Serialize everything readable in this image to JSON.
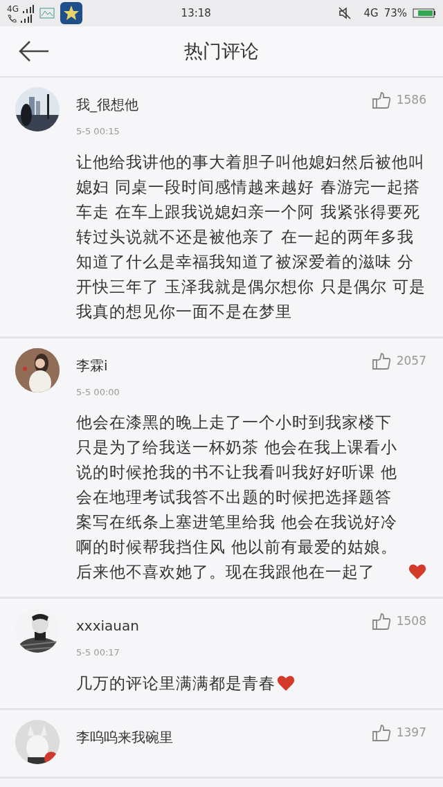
{
  "status_bar": {
    "network_top": "4G",
    "time": "13:18",
    "network_right": "4G",
    "battery": "73%"
  },
  "header": {
    "title": "热门评论"
  },
  "comments": [
    {
      "name": "我_很想他",
      "time": "5-5 00:15",
      "likes": "1586",
      "text": "让他给我讲他的事大着胆子叫他媳妇然后被他叫媳妇 同桌一段时间感情越来越好 春游完一起搭车走 在车上跟我说媳妇亲一个阿 我紧张得要死转过头说就不还是被他亲了 在一起的两年多我知道了什么是幸福我知道了被深爱着的滋味 分开快三年了 玉泽我就是偶尔想你 只是偶尔 可是我真的想见你一面不是在梦里",
      "heart": false
    },
    {
      "name": "李霖i",
      "time": "5-5 00:00",
      "likes": "2057",
      "text": "他会在漆黑的晚上走了一个小时到我家楼下只是为了给我送一杯奶茶 他会在我上课看小说的时候抢我的书不让我看叫我好好听课 他会在地理考试我答不出题的时候把选择题答案写在纸条上塞进笔里给我 他会在我说好冷啊的时候帮我挡住风 他以前有最爱的姑娘。后来他不喜欢她了。现在我跟他在一起了",
      "heart": true
    },
    {
      "name": "xxxiauan",
      "time": "5-5 00:17",
      "likes": "1508",
      "text": "几万的评论里满满都是青春",
      "heart": true
    },
    {
      "name": "李呜呜来我碗里",
      "likes": "1397"
    }
  ]
}
